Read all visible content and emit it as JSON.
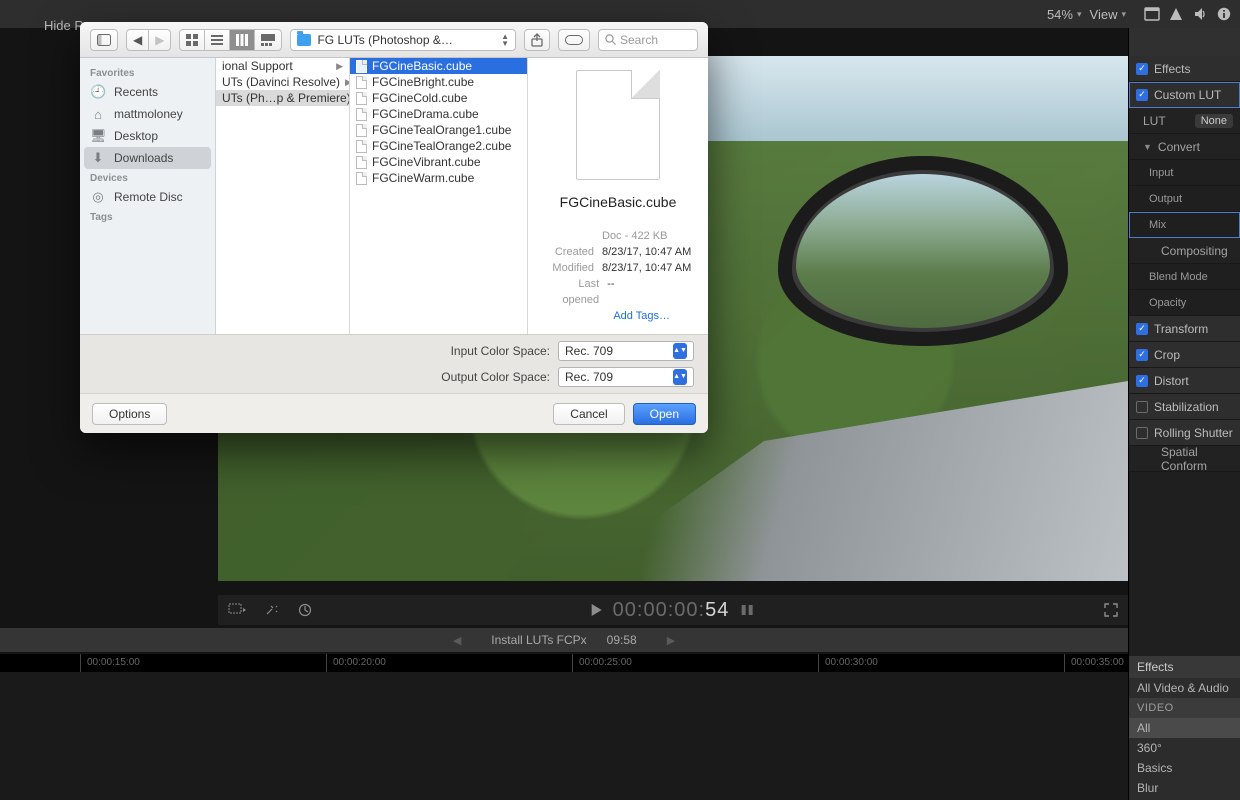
{
  "app": {
    "hide_label": "Hide R",
    "zoom": "54%",
    "view_label": "View"
  },
  "playback": {
    "timecode_prefix": "00:00:00:",
    "timecode_active": "54"
  },
  "clip": {
    "title": "Install LUTs FCPx",
    "duration": "09:58"
  },
  "ruler": [
    {
      "pos": 80,
      "label": "00:00:15:00"
    },
    {
      "pos": 326,
      "label": "00:00:20:00"
    },
    {
      "pos": 572,
      "label": "00:00:25:00"
    },
    {
      "pos": 818,
      "label": "00:00:30:00"
    },
    {
      "pos": 1064,
      "label": "00:00:35:00"
    }
  ],
  "inspector": {
    "effects": "Effects",
    "custom_lut": "Custom LUT",
    "lut_label": "LUT",
    "lut_value": "None",
    "convert": "Convert",
    "input": "Input",
    "output": "Output",
    "mix": "Mix",
    "compositing": "Compositing",
    "blend_mode": "Blend Mode",
    "opacity": "Opacity",
    "transform": "Transform",
    "crop": "Crop",
    "distort": "Distort",
    "stabilization": "Stabilization",
    "rolling_shutter": "Rolling Shutter",
    "spatial_conform": "Spatial Conform"
  },
  "fx": {
    "header": "Effects",
    "items": [
      {
        "label": "All Video & Audio",
        "type": "item"
      },
      {
        "label": "VIDEO",
        "type": "group"
      },
      {
        "label": "All",
        "type": "item"
      },
      {
        "label": "360°",
        "type": "item"
      },
      {
        "label": "Basics",
        "type": "item"
      },
      {
        "label": "Blur",
        "type": "item"
      }
    ]
  },
  "finder": {
    "path_label": "FG LUTs (Photoshop &…",
    "search_placeholder": "Search",
    "sidebar": {
      "favorites": "Favorites",
      "recents": "Recents",
      "home": "mattmoloney",
      "desktop": "Desktop",
      "downloads": "Downloads",
      "devices": "Devices",
      "remote_disc": "Remote Disc",
      "tags": "Tags"
    },
    "col1": [
      "ional Support",
      "UTs (Davinci Resolve)",
      "UTs (Ph…p & Premiere)"
    ],
    "col2": [
      "FGCineBasic.cube",
      "FGCineBright.cube",
      "FGCineCold.cube",
      "FGCineDrama.cube",
      "FGCineTealOrange1.cube",
      "FGCineTealOrange2.cube",
      "FGCineVibrant.cube",
      "FGCineWarm.cube"
    ],
    "preview": {
      "filename": "FGCineBasic.cube",
      "kind": "Doc - 422 KB",
      "created_k": "Created",
      "created_v": "8/23/17, 10:47 AM",
      "modified_k": "Modified",
      "modified_v": "8/23/17, 10:47 AM",
      "lastopened_k": "Last opened",
      "lastopened_v": "--",
      "add_tags": "Add Tags…"
    },
    "options": {
      "input_label": "Input Color Space:",
      "input_value": "Rec. 709",
      "output_label": "Output Color Space:",
      "output_value": "Rec. 709"
    },
    "footer": {
      "options": "Options",
      "cancel": "Cancel",
      "open": "Open"
    }
  }
}
